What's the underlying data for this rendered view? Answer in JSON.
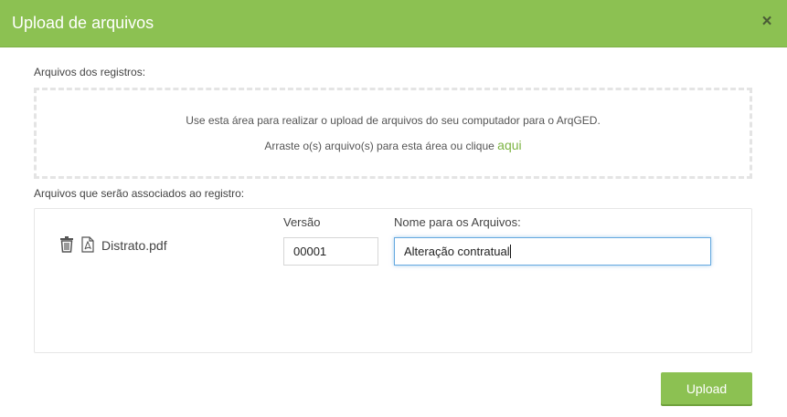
{
  "modal": {
    "title": "Upload de arquivos",
    "close_glyph": "×"
  },
  "dropzone": {
    "section_label": "Arquivos dos registros:",
    "line1": "Use esta área para realizar o upload de arquivos do seu computador para o ArqGED.",
    "line2_prefix": "Arraste o(s) arquivo(s) para esta área ou clique ",
    "line2_link": "aqui"
  },
  "files": {
    "section_label": "Arquivos que serão associados ao registro:",
    "version_header": "Versão",
    "name_header": "Nome para os Arquivos:",
    "rows": [
      {
        "filename": "Distrato.pdf",
        "version": "00001",
        "name": "Alteração contratual"
      }
    ],
    "icons": [
      "trash-icon",
      "pdf-file-icon"
    ]
  },
  "footer": {
    "upload_label": "Upload"
  },
  "colors": {
    "header": "#8cc152",
    "accent_link": "#7cb342",
    "focus_border": "#66a9e0"
  }
}
